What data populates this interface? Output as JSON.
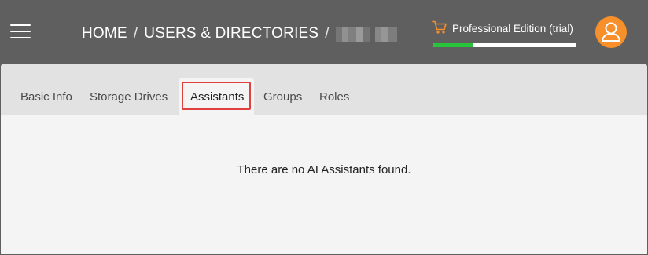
{
  "header": {
    "breadcrumb": {
      "home": "HOME",
      "separator": "/",
      "section": "USERS & DIRECTORIES",
      "current": ""
    },
    "edition": {
      "label": "Professional Edition (trial)",
      "progress_percent": 28,
      "cart_icon": "cart-icon",
      "cart_color": "#f7902b",
      "progress_color": "#27c43c"
    },
    "avatar": {
      "icon": "user-icon",
      "color": "#f7902b"
    },
    "menu_icon": "hamburger-menu-icon"
  },
  "tabs": [
    {
      "label": "Basic Info",
      "active": false
    },
    {
      "label": "Storage Drives",
      "active": false
    },
    {
      "label": "Assistants",
      "active": true
    },
    {
      "label": "Groups",
      "active": false
    },
    {
      "label": "Roles",
      "active": false
    }
  ],
  "content": {
    "empty_message": "There are no AI Assistants found."
  },
  "colors": {
    "header_bg": "#5f5f5f",
    "tabbar_bg": "#e2e2e2",
    "content_bg": "#f4f4f4",
    "highlight": "#e0403f"
  }
}
